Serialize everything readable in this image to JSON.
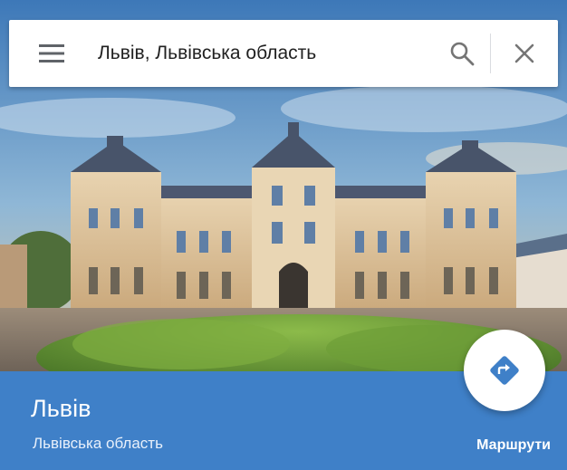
{
  "search": {
    "query": "Львів, Львівська область",
    "menu_icon": "hamburger-menu-icon",
    "search_icon": "search-icon",
    "close_icon": "close-icon"
  },
  "place": {
    "title": "Львів",
    "subtitle": "Львівська область"
  },
  "actions": {
    "directions_label": "Маршрути",
    "directions_icon": "directions-diamond-icon"
  },
  "colors": {
    "panel": "#3f80c8",
    "directions_icon": "#3f80c8",
    "icon_gray": "#5f6368"
  }
}
